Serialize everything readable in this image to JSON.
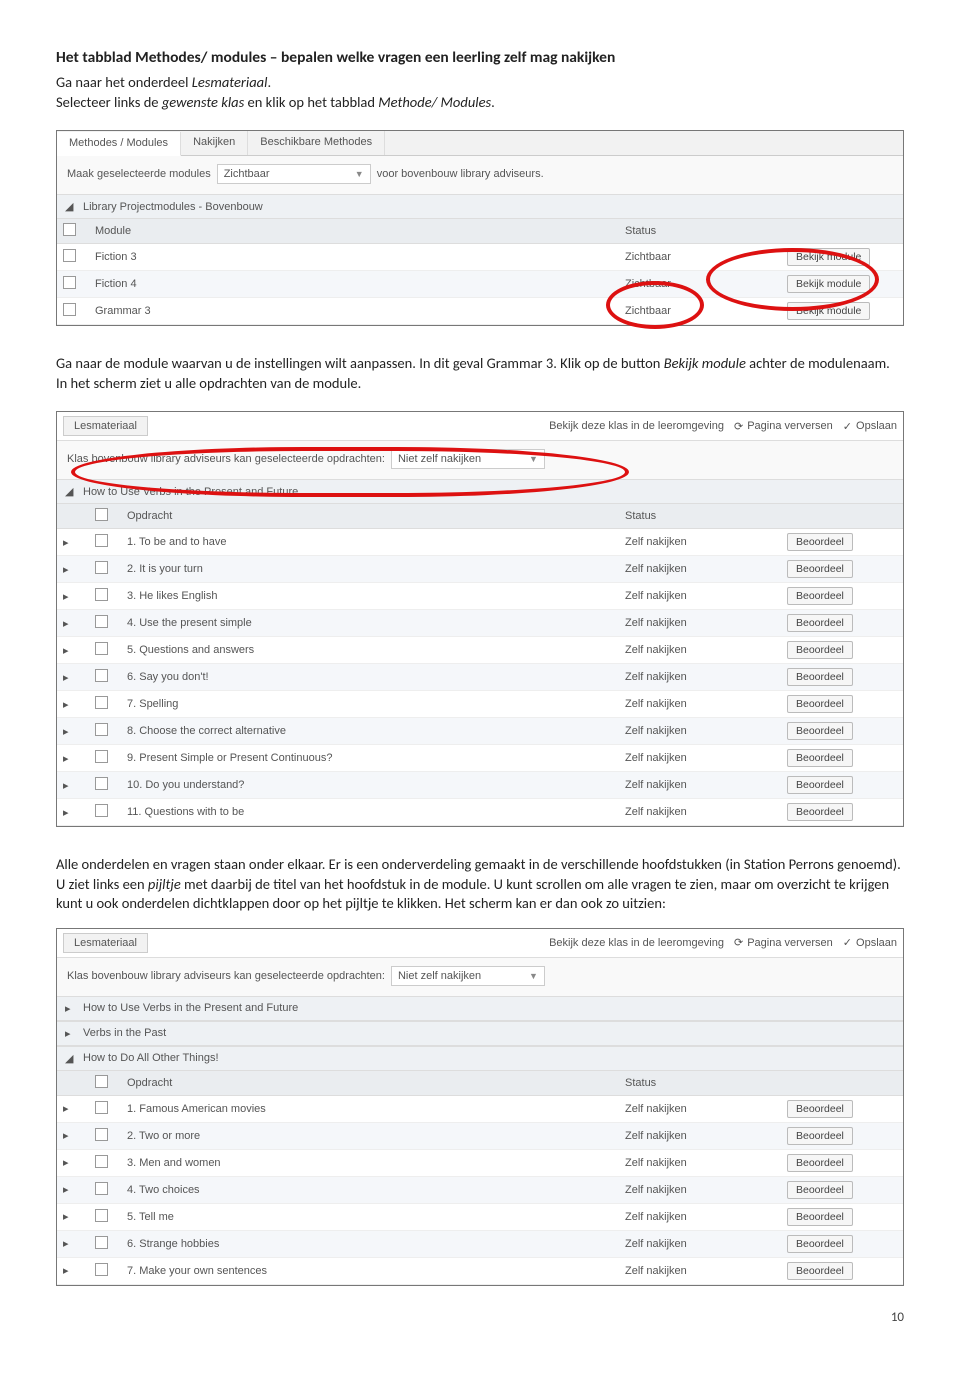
{
  "doc": {
    "heading": "Het tabblad Methodes/ modules – bepalen welke vragen een leerling zelf mag nakijken",
    "p1a": "Ga naar het onderdeel ",
    "p1i": "Lesmateriaal",
    "p1b": ".",
    "p2a": "Selecteer links de ",
    "p2i": "gewenste klas",
    "p2b": " en klik op het tabblad ",
    "p2i2": "Methode/ Modules",
    "p2c": ".",
    "p3a": "Ga naar de module waarvan u de instellingen wilt aanpassen. In dit geval Grammar 3. Klik op de button ",
    "p3i": "Bekijk module",
    "p3b": " achter de modulenaam. In het scherm ziet u alle opdrachten van de module.",
    "p4a": "Alle onderdelen en vragen staan onder elkaar. Er is een onderverdeling gemaakt in de verschillende hoofdstukken (in Station Perrons genoemd). U ziet links een ",
    "p4i": "pijltje",
    "p4b": " met daarbij de titel van het hoofdstuk in de module. U kunt scrollen om alle vragen te zien, maar om overzicht te krijgen kunt u ook onderdelen dichtklappen door op het pijltje te klikken. Het scherm kan er dan ook zo uitzien:",
    "page_number": "10"
  },
  "shot1": {
    "tabs": [
      "Methodes / Modules",
      "Nakijken",
      "Beschikbare Methodes"
    ],
    "toolbar_pre": "Maak geselecteerde modules",
    "toolbar_dd": "Zichtbaar",
    "toolbar_post": "voor bovenbouw library adviseurs.",
    "section": "Library Projectmodules - Bovenbouw",
    "headers": {
      "module": "Module",
      "status": "Status"
    },
    "rows": [
      {
        "name": "Fiction 3",
        "status": "Zichtbaar",
        "btn": "Bekijk module"
      },
      {
        "name": "Fiction 4",
        "status": "Zichtbaar",
        "btn": "Bekijk module"
      },
      {
        "name": "Grammar 3",
        "status": "Zichtbaar",
        "btn": "Bekijk module"
      }
    ]
  },
  "shot2": {
    "crumb": "Lesmateriaal",
    "top_link1": "Bekijk deze klas in de leeromgeving",
    "top_link2": "Pagina verversen",
    "top_link3": "Opslaan",
    "toolbar_pre": "Klas bovenbouw library adviseurs kan geselecteerde opdrachten:",
    "toolbar_dd": "Niet zelf nakijken",
    "section": "How to Use Verbs in the Present and Future",
    "headers": {
      "opdracht": "Opdracht",
      "status": "Status"
    },
    "status_value": "Zelf nakijken",
    "btn": "Beoordeel",
    "rows": [
      "1.  To be and to have",
      "2.  It is your turn",
      "3.  He likes English",
      "4.  Use the present simple",
      "5.  Questions and answers",
      "6.  Say you don't!",
      "7.  Spelling",
      "8.  Choose the correct alternative",
      "9.  Present Simple or Present Continuous?",
      "10.  Do you understand?",
      "11.  Questions with to be"
    ]
  },
  "shot3": {
    "crumb": "Lesmateriaal",
    "top_link1": "Bekijk deze klas in de leeromgeving",
    "top_link2": "Pagina verversen",
    "top_link3": "Opslaan",
    "toolbar_pre": "Klas bovenbouw library adviseurs kan geselecteerde opdrachten:",
    "toolbar_dd": "Niet zelf nakijken",
    "sections_collapsed": [
      "How to Use Verbs in the Present and Future",
      "Verbs in the Past"
    ],
    "section_open": "How to Do All Other Things!",
    "headers": {
      "opdracht": "Opdracht",
      "status": "Status"
    },
    "status_value": "Zelf nakijken",
    "btn": "Beoordeel",
    "rows": [
      "1.  Famous American movies",
      "2.  Two or more",
      "3.  Men and women",
      "4.  Two choices",
      "5.  Tell me",
      "6.  Strange hobbies",
      "7.  Make your own sentences"
    ]
  }
}
